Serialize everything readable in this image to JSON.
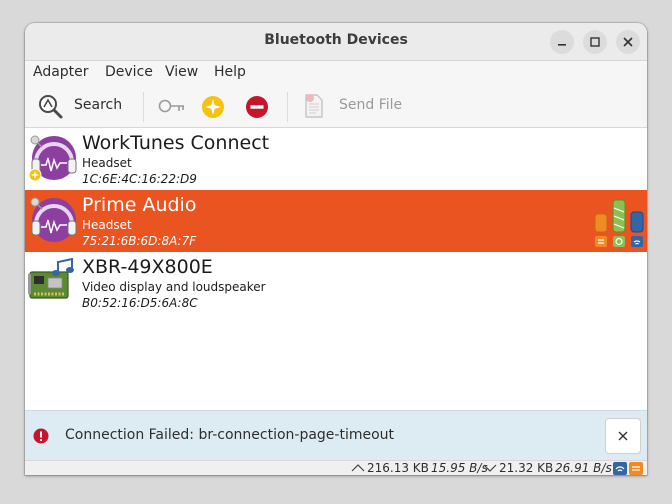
{
  "window": {
    "title": "Bluetooth Devices"
  },
  "menubar": {
    "items": [
      "Adapter",
      "Device",
      "View",
      "Help"
    ]
  },
  "toolbar": {
    "search_label": "Search",
    "send_file_label": "Send File"
  },
  "devices": [
    {
      "name": "WorkTunes Connect",
      "type": "Headset",
      "address": "1C:6E:4C:16:22:D9",
      "icon": "headset-icon",
      "selected": false
    },
    {
      "name": "Prime Audio",
      "type": "Headset",
      "address": "75:21:6B:6D:8A:7F",
      "icon": "headset-icon",
      "selected": true
    },
    {
      "name": "XBR-49X800E",
      "type": "Video display and loudspeaker",
      "address": "B0:52:16:D5:6A:8C",
      "icon": "audio-card-icon",
      "selected": false
    }
  ],
  "infobar": {
    "message": "Connection Failed: br-connection-page-timeout"
  },
  "statusbar": {
    "upload_total": "216.13 KB",
    "upload_rate": "15.95 B/s",
    "download_total": "21.32 KB",
    "download_rate": "26.91 B/s"
  },
  "colors": {
    "accent": "#e95420",
    "info_bg": "#dcecf2",
    "error": "#c7162b",
    "trust": "#f5c211"
  }
}
